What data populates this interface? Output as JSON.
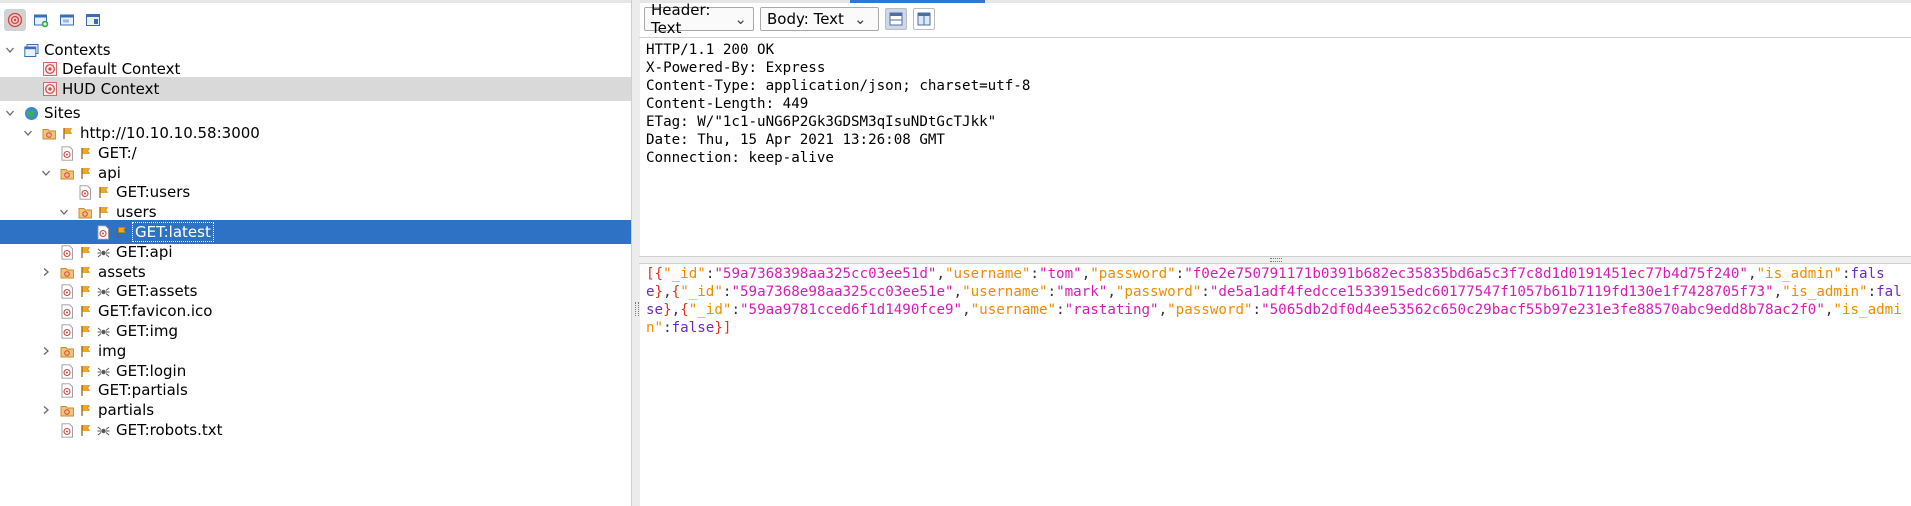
{
  "colors": {
    "selection": "#2d72c4",
    "accent": "#2f78d1",
    "json_key": "#f08c00",
    "json_string": "#d91bb6",
    "json_bool": "#6a2cc9",
    "json_punct": "#e0301e"
  },
  "left_toolbar": {
    "icons": [
      "target-icon",
      "new-context-icon",
      "context-list-icon",
      "window-icon"
    ]
  },
  "tree": [
    {
      "depth": 0,
      "expander": "open",
      "icon": "contexts-folder-icon",
      "label": "Contexts"
    },
    {
      "depth": 1,
      "expander": "none",
      "icon": "target-icon",
      "label": "Default Context"
    },
    {
      "depth": 1,
      "expander": "none",
      "icon": "target-icon",
      "label": "HUD Context",
      "highlight": true
    },
    {
      "depth": 0,
      "expander": "open",
      "icon": "globe-icon",
      "label": "Sites"
    },
    {
      "depth": 1,
      "expander": "open",
      "icon": "folder-flag-icon",
      "label": "http://10.10.10.58:3000"
    },
    {
      "depth": 2,
      "expander": "none",
      "icon": "node-flag-icon",
      "label": "GET:/"
    },
    {
      "depth": 2,
      "expander": "open",
      "icon": "folder-flag-icon",
      "label": "api"
    },
    {
      "depth": 3,
      "expander": "none",
      "icon": "node-flag-icon",
      "label": "GET:users"
    },
    {
      "depth": 3,
      "expander": "open",
      "icon": "folder-flag-icon",
      "label": "users"
    },
    {
      "depth": 4,
      "expander": "none",
      "icon": "node-flag-icon",
      "label": "GET:latest",
      "selected": true
    },
    {
      "depth": 2,
      "expander": "none",
      "icon": "node-flag-spider-icon",
      "label": "GET:api"
    },
    {
      "depth": 2,
      "expander": "closed",
      "icon": "folder-flag-icon",
      "label": "assets"
    },
    {
      "depth": 2,
      "expander": "none",
      "icon": "node-flag-spider-icon",
      "label": "GET:assets"
    },
    {
      "depth": 2,
      "expander": "none",
      "icon": "node-flag-icon",
      "label": "GET:favicon.ico"
    },
    {
      "depth": 2,
      "expander": "none",
      "icon": "node-flag-spider-icon",
      "label": "GET:img"
    },
    {
      "depth": 2,
      "expander": "closed",
      "icon": "folder-flag-icon",
      "label": "img"
    },
    {
      "depth": 2,
      "expander": "none",
      "icon": "node-flag-spider-icon",
      "label": "GET:login"
    },
    {
      "depth": 2,
      "expander": "none",
      "icon": "node-flag-icon",
      "label": "GET:partials"
    },
    {
      "depth": 2,
      "expander": "closed",
      "icon": "folder-flag-icon",
      "label": "partials"
    },
    {
      "depth": 2,
      "expander": "none",
      "icon": "node-flag-spider-icon",
      "label": "GET:robots.txt"
    }
  ],
  "right_toolbar": {
    "header_select": "Header: Text",
    "body_select": "Body: Text",
    "view_buttons": [
      "split-vertical-icon",
      "split-horizontal-icon"
    ]
  },
  "response_headers": [
    "HTTP/1.1 200 OK",
    "X-Powered-By: Express",
    "Content-Type: application/json; charset=utf-8",
    "Content-Length: 449",
    "ETag: W/\"1c1-uNG6P2Gk3GDSM3qIsuNDtGcTJkk\"",
    "Date: Thu, 15 Apr 2021 13:26:08 GMT",
    "Connection: keep-alive"
  ],
  "response_body": [
    {
      "_id": "59a7368398aa325cc03ee51d",
      "username": "tom",
      "password": "f0e2e750791171b0391b682ec35835bd6a5c3f7c8d1d0191451ec77b4d75f240",
      "is_admin": "false"
    },
    {
      "_id": "59a7368e98aa325cc03ee51e",
      "username": "mark",
      "password": "de5a1adf4fedcce1533915edc60177547f1057b61b7119fd130e1f7428705f73",
      "is_admin": "false"
    },
    {
      "_id": "59aa9781cced6f1d1490fce9",
      "username": "rastating",
      "password": "5065db2df0d4ee53562c650c29bacf55b97e231e3fe88570abc9edd8b78ac2f0",
      "is_admin": "false"
    }
  ]
}
